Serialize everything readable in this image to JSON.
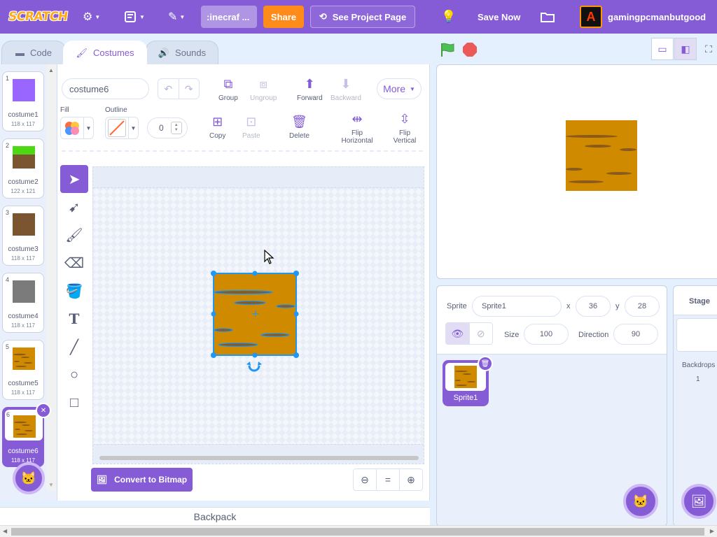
{
  "menubar": {
    "logo": "SCRATCH",
    "project_title": ":inecraf ...",
    "share_label": "Share",
    "see_project_label": "See Project Page",
    "save_label": "Save Now",
    "username": "gamingpcmanbutgood",
    "avatar_letter": "A",
    "icons": [
      "gear-icon",
      "file-icon",
      "edit-icon",
      "lightbulb-icon",
      "folder-icon"
    ]
  },
  "tabs": [
    {
      "label": "Code",
      "icon": "code-icon"
    },
    {
      "label": "Costumes",
      "icon": "brush-icon",
      "active": true
    },
    {
      "label": "Sounds",
      "icon": "speaker-icon"
    }
  ],
  "costumes": [
    {
      "num": "1",
      "name": "costume1",
      "size": "118 x 117",
      "thumb": "purple"
    },
    {
      "num": "2",
      "name": "costume2",
      "size": "122 x 121",
      "thumb": "grass"
    },
    {
      "num": "3",
      "name": "costume3",
      "size": "118 x 117",
      "thumb": "dirt"
    },
    {
      "num": "4",
      "name": "costume4",
      "size": "118 x 117",
      "thumb": "stone"
    },
    {
      "num": "5",
      "name": "costume5",
      "size": "118 x 117",
      "thumb": "wood"
    },
    {
      "num": "6",
      "name": "costume6",
      "size": "118 x 117",
      "thumb": "wood",
      "selected": true
    }
  ],
  "editor": {
    "costume_name": "costume6",
    "group_label": "Group",
    "ungroup_label": "Ungroup",
    "forward_label": "Forward",
    "backward_label": "Backward",
    "more_label": "More",
    "fill_label": "Fill",
    "outline_label": "Outline",
    "outline_width": "0",
    "copy_label": "Copy",
    "paste_label": "Paste",
    "delete_label": "Delete",
    "flip_h_label": "Flip Horizontal",
    "flip_v_label": "Flip Vertical",
    "convert_label": "Convert to Bitmap",
    "tools": [
      "select-tool",
      "reshape-tool",
      "brush-tool",
      "eraser-tool",
      "fill-tool",
      "text-tool",
      "line-tool",
      "circle-tool",
      "rectangle-tool"
    ],
    "zoom": {
      "out": "−",
      "reset": "=",
      "in": "+"
    }
  },
  "backpack_label": "Backpack",
  "sprite": {
    "sprite_label": "Sprite",
    "name": "Sprite1",
    "x_label": "x",
    "x": "36",
    "y_label": "y",
    "y": "28",
    "size_label": "Size",
    "size": "100",
    "direction_label": "Direction",
    "direction": "90",
    "tile_name": "Sprite1"
  },
  "stage_pane": {
    "title": "Stage",
    "backdrops_label": "Backdrops",
    "backdrops_count": "1"
  },
  "colors": {
    "accent": "#855cd6",
    "share": "#ff8c1a",
    "wood": "#d08a00",
    "selection": "#2196f3"
  }
}
